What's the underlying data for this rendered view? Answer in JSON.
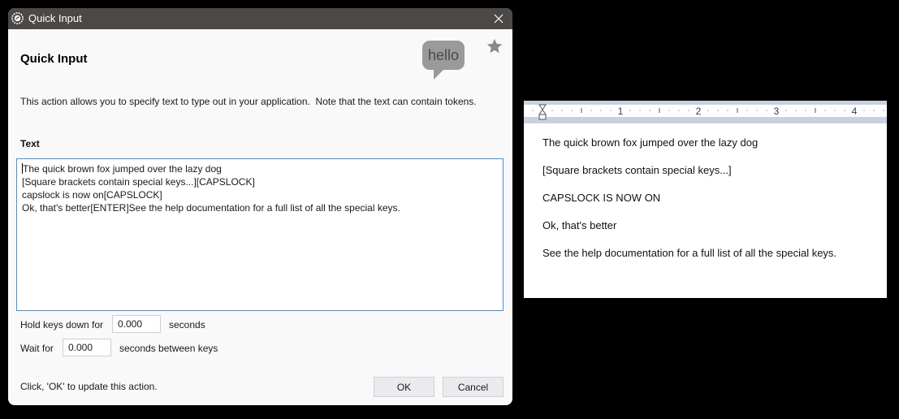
{
  "dialog": {
    "title": "Quick Input",
    "heading": "Quick Input",
    "bubble_text": "hello",
    "description": "This action allows you to specify text to type out in your application.  Note that the text can contain tokens.",
    "text_label": "Text",
    "text_lines": [
      "The quick brown fox jumped over the lazy dog",
      "[Square brackets contain special keys...][CAPSLOCK]",
      "capslock is now on[CAPSLOCK]",
      "Ok, that's better[ENTER]See the help documentation for a full list of all the special keys."
    ],
    "hold_label": "Hold keys down for",
    "hold_value": "0.000",
    "hold_unit": "seconds",
    "wait_label": "Wait for",
    "wait_value": "0.000",
    "wait_unit": "seconds between keys",
    "footer": "Click, 'OK' to update this action.",
    "ok_label": "OK",
    "cancel_label": "Cancel",
    "accent_color": "#3c93dd"
  },
  "document": {
    "ruler_numbers": [
      "1",
      "2",
      "3",
      "4"
    ],
    "lines": [
      "The quick brown fox jumped over the lazy dog",
      "[Square brackets contain special keys...]",
      "CAPSLOCK IS NOW ON",
      "Ok, that's better",
      "See the help documentation for a full list of all the special keys."
    ]
  }
}
